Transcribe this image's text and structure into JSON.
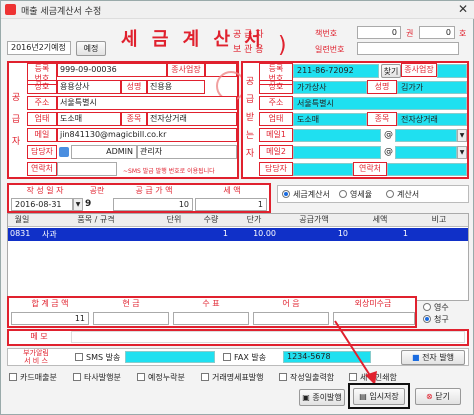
{
  "window": {
    "title": "매출 세금계산서 수정",
    "close": "✕"
  },
  "top": {
    "year_select": "2016년2기예정",
    "year_btn": "예정",
    "title": "세 금 계 산 서",
    "supplier_copy": "공 급 자",
    "keeper_copy": "보 관 용",
    "book_label": "책번호",
    "book_val": "0",
    "kwon": "권",
    "ho_val": "0",
    "ho": "호",
    "serial_label": "일련번호"
  },
  "supplier": {
    "side": [
      "공",
      "급",
      "자"
    ],
    "reg_label": "등록\n번호",
    "reg": "999-09-00036",
    "sub_label": "종사업장",
    "company_label": "상호",
    "company": "용용상사",
    "name_label": "성명",
    "name": "진용용",
    "addr_label": "주소",
    "addr": "서울특별시",
    "biz_label": "업태",
    "biz": "도소매",
    "item_label": "종목",
    "item": "전자상거래",
    "mail_label": "메일",
    "mail": "jin841130@magicbill.co.kr",
    "person_label": "담당자",
    "person_id": "ADMIN",
    "person": "관리자",
    "contact_label": "연락처",
    "notice": "~SMS 발급 발행 번호로 이용됩니다"
  },
  "buyer": {
    "side": [
      "공",
      "급",
      "받",
      "는",
      "자"
    ],
    "reg_label": "등록\n번호",
    "reg": "211-86-72092",
    "search": "찾기",
    "sub_label": "종사업장",
    "company_label": "상호",
    "company": "가가상사",
    "name_label": "성명",
    "name": "김가가",
    "addr_label": "주소",
    "addr": "서울특별시",
    "biz_label": "업태",
    "biz": "도소매",
    "item_label": "종목",
    "item": "전자상거래",
    "mail1_label": "메일1",
    "mail2_label": "메일2",
    "at": "@",
    "person_label": "담당자",
    "contact_label": "연락처"
  },
  "summary": {
    "date_label": "작 성 일 자",
    "blank_label": "공란",
    "supply_label": "공 급 가 액",
    "tax_label": "세 액",
    "date": "2016-08-31",
    "blank": "9",
    "supply": "10",
    "tax": "1",
    "kinds": [
      "세금계산서",
      "영세율",
      "계산서"
    ]
  },
  "items": {
    "headers": [
      "월일",
      "품목 / 규격",
      "단위",
      "수량",
      "단가",
      "공급가액",
      "세액",
      "비고"
    ],
    "rows": [
      {
        "date": "0831",
        "name": "사과",
        "unit": "",
        "qty": "1",
        "price": "10.00",
        "supply": "10",
        "tax": "1",
        "note": ""
      }
    ]
  },
  "totals": {
    "total_label": "합 계 금 액",
    "cash_label": "현 금",
    "check_label": "수 표",
    "note_label": "어 음",
    "credit_label": "외상미수금",
    "total": "11",
    "receipt": "영수",
    "claim": "청구"
  },
  "memo": {
    "label": "메 모"
  },
  "extra": {
    "service_label": "부가알림\n서 비 스",
    "sms": "SMS 발송",
    "fax": "FAX 발송",
    "fax_num": "1234-5678",
    "esend": "전자 발행"
  },
  "options": [
    "카드매출분",
    "타사발행분",
    "예정누락분",
    "거래명세표발행",
    "작성일출력함",
    "세액인쇄함"
  ],
  "buttons": {
    "paper": "종이발행",
    "save": "임시저장",
    "close": "닫기"
  }
}
